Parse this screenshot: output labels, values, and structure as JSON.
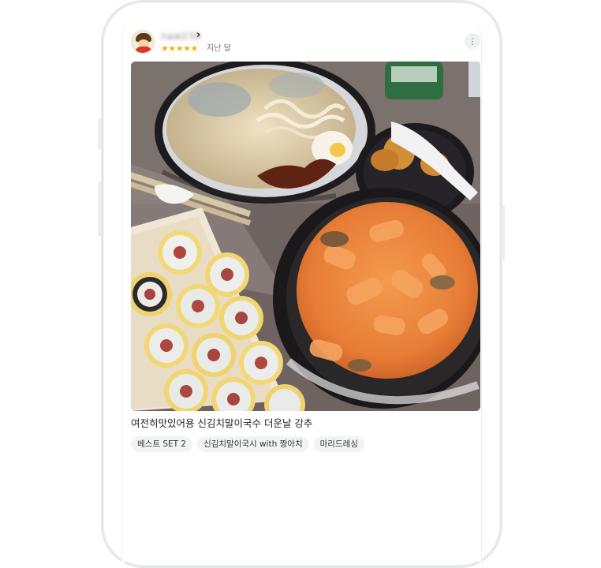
{
  "review": {
    "username": "naw239",
    "rating_stars": "★★★★★",
    "rating": 5,
    "date": "지난 달",
    "photo_alt": "음식 사진",
    "caption": "여전히맛있어용 신김치말이국수 더운날 강추",
    "tags": [
      "베스트 SET 2",
      "신김치말이국시 with 짱아치",
      "마리드레싱"
    ]
  },
  "icons": {
    "chevron": "›",
    "more": "⋮"
  },
  "colors": {
    "star": "#f5b400",
    "tag_bg": "#f2f3f5",
    "phone_frame": "#e6e7ea"
  }
}
